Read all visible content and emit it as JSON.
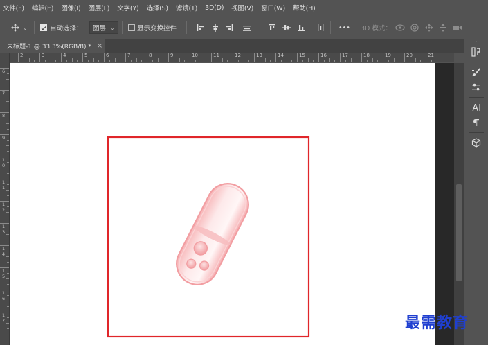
{
  "menubar": {
    "items": [
      {
        "label": "文件(F)"
      },
      {
        "label": "编辑(E)"
      },
      {
        "label": "图像(I)"
      },
      {
        "label": "图层(L)"
      },
      {
        "label": "文字(Y)"
      },
      {
        "label": "选择(S)"
      },
      {
        "label": "滤镜(T)"
      },
      {
        "label": "3D(D)"
      },
      {
        "label": "视图(V)"
      },
      {
        "label": "窗口(W)"
      },
      {
        "label": "帮助(H)"
      }
    ]
  },
  "options": {
    "move_tool_icon": "move-icon",
    "auto_select_label": "自动选择：",
    "auto_select_checked": true,
    "layer_select_value": "图层",
    "show_transform_label": "显示变换控件",
    "show_transform_checked": false,
    "more_label": "•••",
    "mode_3d_label": "3D 模式："
  },
  "document": {
    "tab_title": "未标题-1 @ 33.3%(RGB/8) *",
    "tab_close": "×"
  },
  "ruler": {
    "top_labels": [
      "2",
      "3",
      "4",
      "5",
      "6",
      "7",
      "8",
      "9",
      "10",
      "11",
      "12",
      "13",
      "14",
      "15",
      "16",
      "17",
      "18",
      "19",
      "20",
      "21"
    ],
    "left_labels": [
      "6",
      "7",
      "8",
      "9",
      "1\n0",
      "1\n1",
      "1\n2",
      "1\n3",
      "1\n4",
      "1\n5",
      "1\n6",
      "1\n7"
    ]
  },
  "watermark": {
    "text": "最需教育"
  },
  "colors": {
    "selection_frame": "#e0262a",
    "pill_tint": "#f4a6a8",
    "watermark": "#1f3fd0"
  }
}
